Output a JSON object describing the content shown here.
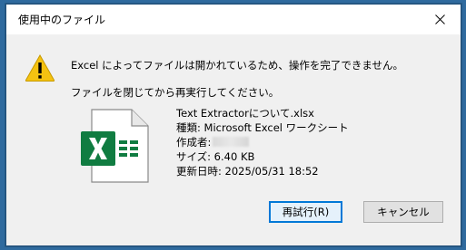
{
  "window": {
    "title": "使用中のファイル",
    "close_symbol": "✕"
  },
  "message": {
    "line1": "Excel によってファイルは開かれているため、操作を完了できません。",
    "line2": "ファイルを閉じてから再実行してください。"
  },
  "file_info": {
    "name": "Text Extractorについて.xlsx",
    "type": "種類: Microsoft Excel ワークシート",
    "author_label": "作成者:",
    "size": "サイズ: 6.40 KB",
    "modified": "更新日時: 2025/05/31 18:52"
  },
  "buttons": {
    "retry": "再試行(R)",
    "cancel": "キャンセル"
  },
  "icons": {
    "warning": "warning-icon",
    "file": "excel-file-icon",
    "close": "close-icon"
  },
  "colors": {
    "accent": "#0078d7",
    "excel_green": "#107c41",
    "warning_yellow": "#f5c211"
  }
}
